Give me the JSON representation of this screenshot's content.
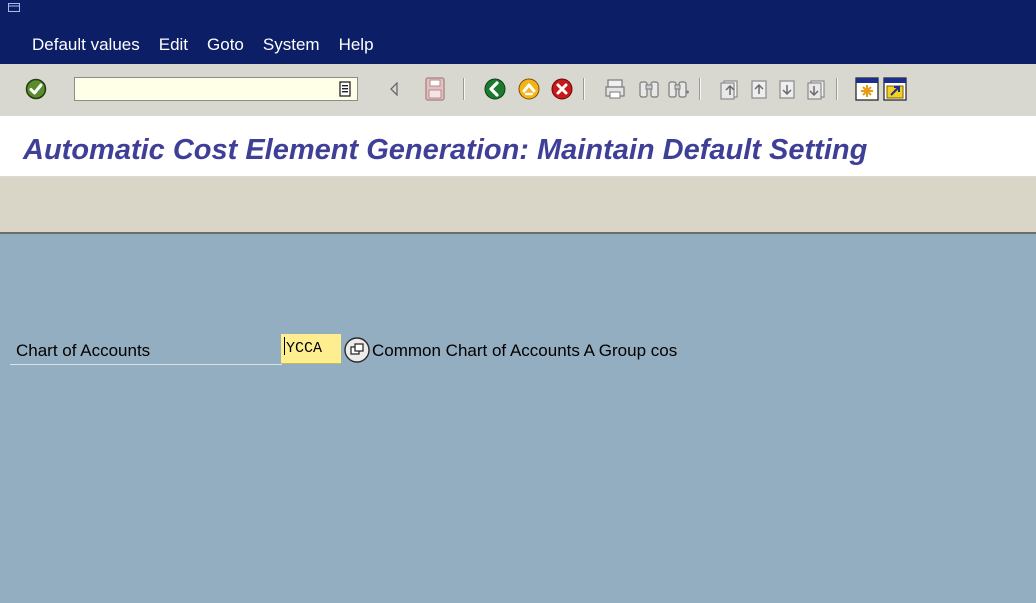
{
  "menubar": {
    "items": [
      {
        "label": "Default values"
      },
      {
        "label": "Edit"
      },
      {
        "label": "Goto"
      },
      {
        "label": "System"
      },
      {
        "label": "Help"
      }
    ]
  },
  "toolbar": {
    "command_field": {
      "value": "",
      "placeholder": ""
    },
    "icons": [
      "enter-check-icon",
      "command-history-icon",
      "back-triangle-icon",
      "save-icon",
      "back-icon",
      "exit-icon",
      "cancel-icon",
      "print-icon",
      "find-icon",
      "find-next-icon",
      "first-page-icon",
      "previous-page-icon",
      "next-page-icon",
      "last-page-icon",
      "create-session-icon",
      "shortcut-icon"
    ]
  },
  "title": {
    "text": "Automatic Cost Element Generation: Maintain Default Setting"
  },
  "form": {
    "chart_of_accounts": {
      "label": "Chart of Accounts",
      "value": "YCCA",
      "description": "Common Chart of Accounts A Group cos"
    }
  },
  "colors": {
    "menubar_bg": "#0c1f66",
    "toolbar_bg": "#d8d8d0",
    "title_color": "#3f3f98",
    "app_toolbar_bg": "#d9d6c8",
    "content_bg": "#93aec0",
    "input_highlight": "#ffee90"
  }
}
